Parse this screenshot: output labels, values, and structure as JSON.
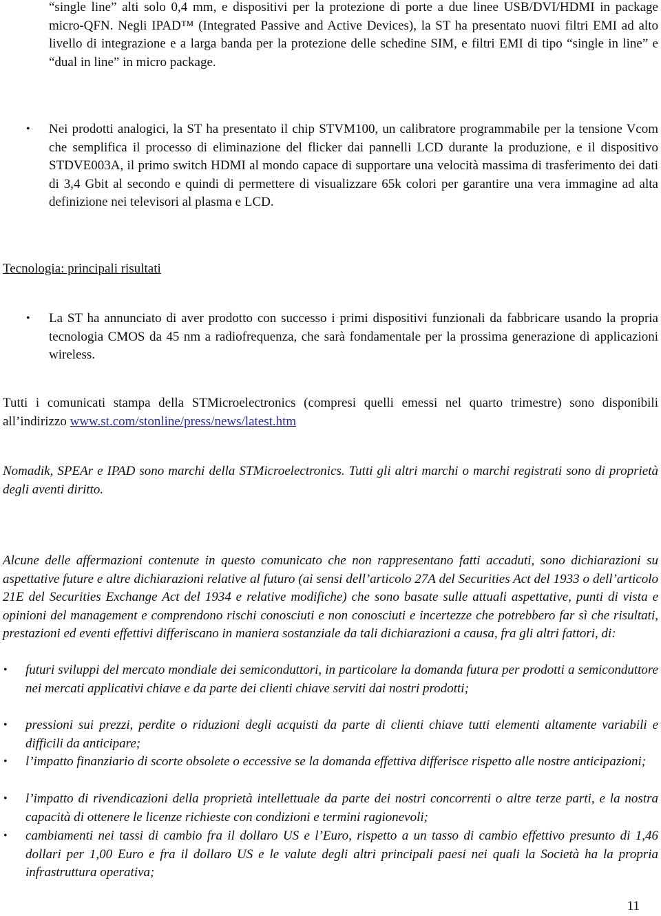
{
  "continuation_paragraph": "“single line” alti solo 0,4 mm, e dispositivi per la protezione di porte a due linee USB/DVI/HDMI in package micro-QFN. Negli IPAD™ (Integrated Passive and Active Devices), la ST ha presentato nuovi filtri EMI ad alto livello di integrazione e a larga banda per la protezione delle schedine SIM, e filtri EMI di tipo “single in line” e “dual in line” in micro package.",
  "analog_bullet": "Nei prodotti analogici, la ST ha presentato il chip STVM100, un calibratore programmabile per la tensione Vcom che semplifica il processo di eliminazione del flicker dai pannelli LCD durante la produzione, e il dispositivo STDVE003A, il primo switch HDMI al mondo capace di supportare una velocità massima di trasferimento dei dati di 3,4 Gbit al secondo e quindi di permettere di visualizzare 65k colori per garantire una vera immagine ad alta definizione nei televisori al plasma e LCD.",
  "section_heading": "Tecnologia: principali risultati",
  "technology_bullet": "La ST ha annunciato di aver prodotto con successo i primi dispositivi funzionali da fabbricare usando la propria tecnologia CMOS da 45 nm a radiofrequenza, che sarà fondamentale per la prossima generazione di applicazioni wireless.",
  "press_release_text": "Tutti i comunicati stampa della STMicroelectronics (compresi quelli emessi nel quarto trimestre) sono disponibili all’indirizzo ",
  "press_release_link": "www.st.com/stonline/press/news/latest.htm",
  "trademark_note": "Nomadik, SPEAr e IPAD sono marchi della STMicroelectronics. Tutti gli altri marchi o marchi registrati sono di proprietà degli aventi diritto.",
  "disclaimer_intro": "Alcune delle affermazioni contenute in questo comunicato che non rappresentano fatti accaduti, sono dichiarazioni su aspettative future e altre dichiarazioni relative al futuro (ai sensi dell’articolo 27A del Securities Act del 1933 o dell’articolo 21E del Securities Exchange Act del 1934 e relative modifiche) che sono basate sulle attuali aspettative, punti di vista e opinioni del management e comprendono rischi conosciuti e non conosciuti e incertezze che potrebbero far sì che risultati, prestazioni ed eventi effettivi differiscano in maniera sostanziale da tali dichiarazioni a causa, fra gli altri fattori, di:",
  "risk_factors": [
    "futuri sviluppi del mercato mondiale dei semiconduttori, in particolare la domanda futura per prodotti a semiconduttore nei mercati applicativi chiave e da parte dei clienti chiave serviti dai nostri prodotti;",
    "pressioni sui prezzi, perdite o riduzioni degli acquisti da parte di clienti chiave tutti elementi altamente variabili e difficili da anticipare;",
    "l’impatto finanziario di scorte obsolete o eccessive se la domanda effettiva differisce rispetto alle nostre anticipazioni;",
    "l’impatto di rivendicazioni della proprietà intellettuale da parte dei nostri concorrenti o altre terze parti, e la nostra capacità di ottenere le licenze richieste con condizioni e termini ragionevoli;",
    "cambiamenti nei tassi di cambio fra il dollaro US e l’Euro, rispetto a un tasso di cambio effettivo presunto di 1,46 dollari per 1,00 Euro e fra il dollaro US e le valute degli altri principali paesi nei quali la Società ha la propria infrastruttura operativa;"
  ],
  "bullet_glyph": "•",
  "page_number": "11",
  "link_color": "#2b2ba8"
}
